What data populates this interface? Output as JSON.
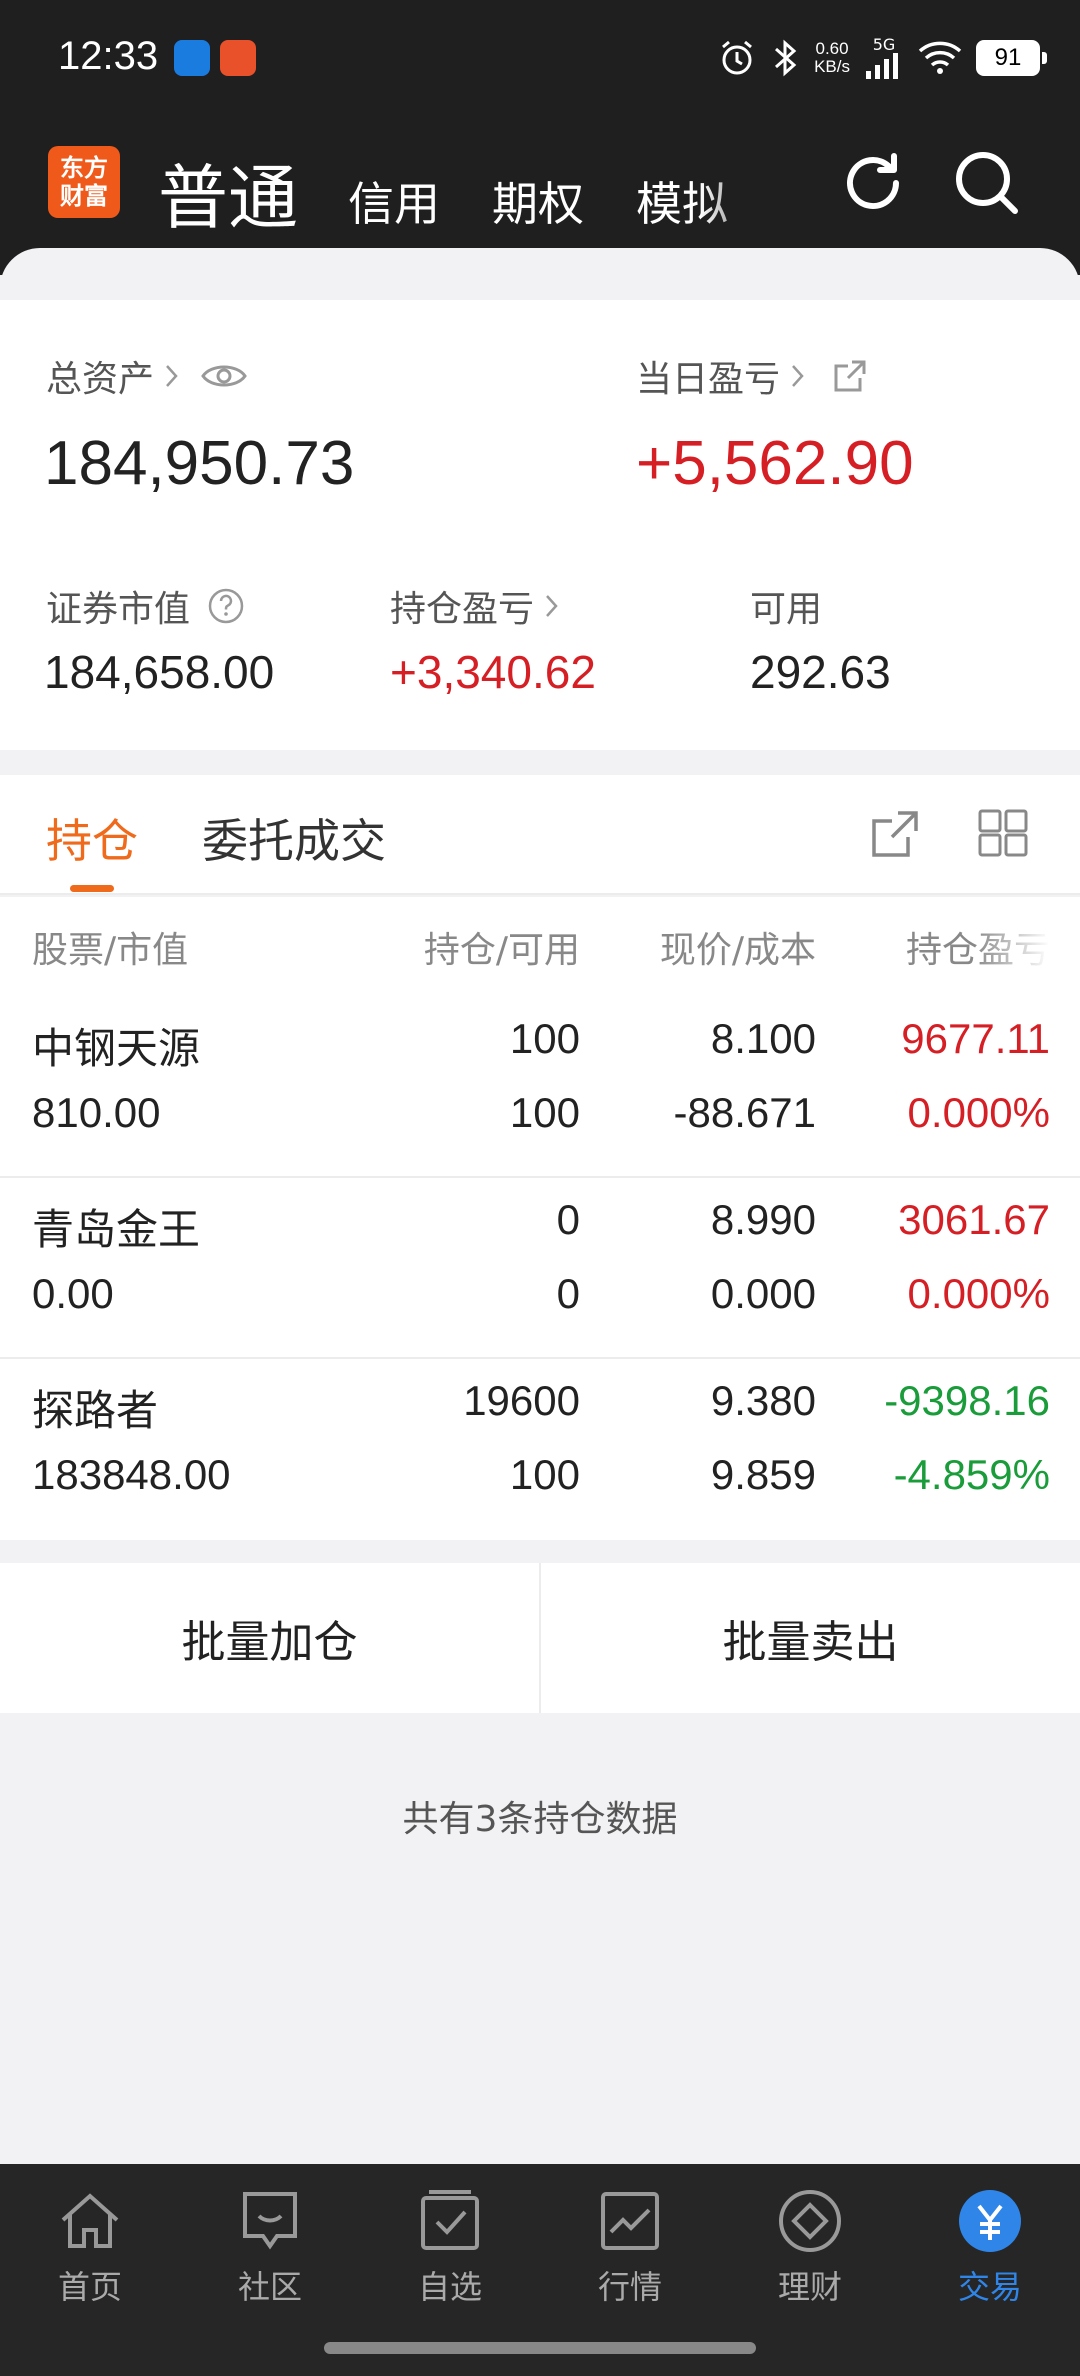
{
  "status": {
    "time": "12:33",
    "net_speed_value": "0.60",
    "net_speed_unit": "KB/s",
    "network": "5G",
    "battery": "91"
  },
  "header": {
    "logo_line1": "东方",
    "logo_line2": "财富",
    "tabs": [
      "普通",
      "信用",
      "期权",
      "模拟"
    ]
  },
  "assets": {
    "total_label": "总资产",
    "total_value": "184,950.73",
    "daily_label": "当日盈亏",
    "daily_value": "+5,562.90",
    "market_label": "证券市值",
    "market_value": "184,658.00",
    "position_pl_label": "持仓盈亏",
    "position_pl_value": "+3,340.62",
    "available_label": "可用",
    "available_value": "292.63"
  },
  "tabs": {
    "holdings": "持仓",
    "orders": "委托成交"
  },
  "table": {
    "headers": [
      "股票/市值",
      "持仓/可用",
      "现价/成本",
      "持仓盈亏"
    ],
    "rows": [
      {
        "name": "中钢天源",
        "market_value": "810.00",
        "position": "100",
        "available": "100",
        "price": "8.100",
        "cost": "-88.671",
        "pl": "9677.11",
        "pl_pct": "0.000%",
        "trend": "up"
      },
      {
        "name": "青岛金王",
        "market_value": "0.00",
        "position": "0",
        "available": "0",
        "price": "8.990",
        "cost": "0.000",
        "pl": "3061.67",
        "pl_pct": "0.000%",
        "trend": "up"
      },
      {
        "name": "探路者",
        "market_value": "183848.00",
        "position": "19600",
        "available": "100",
        "price": "9.380",
        "cost": "9.859",
        "pl": "-9398.16",
        "pl_pct": "-4.859%",
        "trend": "down"
      }
    ]
  },
  "actions": {
    "batch_add": "批量加仓",
    "batch_sell": "批量卖出"
  },
  "footer_note": "共有3条持仓数据",
  "bottom_nav": [
    {
      "label": "首页",
      "icon": "home-icon"
    },
    {
      "label": "社区",
      "icon": "chat-icon"
    },
    {
      "label": "自选",
      "icon": "watchlist-icon"
    },
    {
      "label": "行情",
      "icon": "market-chart-icon"
    },
    {
      "label": "理财",
      "icon": "finance-diamond-icon"
    },
    {
      "label": "交易",
      "icon": "yuan-trade-icon"
    }
  ],
  "colors": {
    "accent": "#ef6a1b",
    "up": "#d51f25",
    "down": "#1a9c3a",
    "active_nav": "#2f86e8"
  }
}
